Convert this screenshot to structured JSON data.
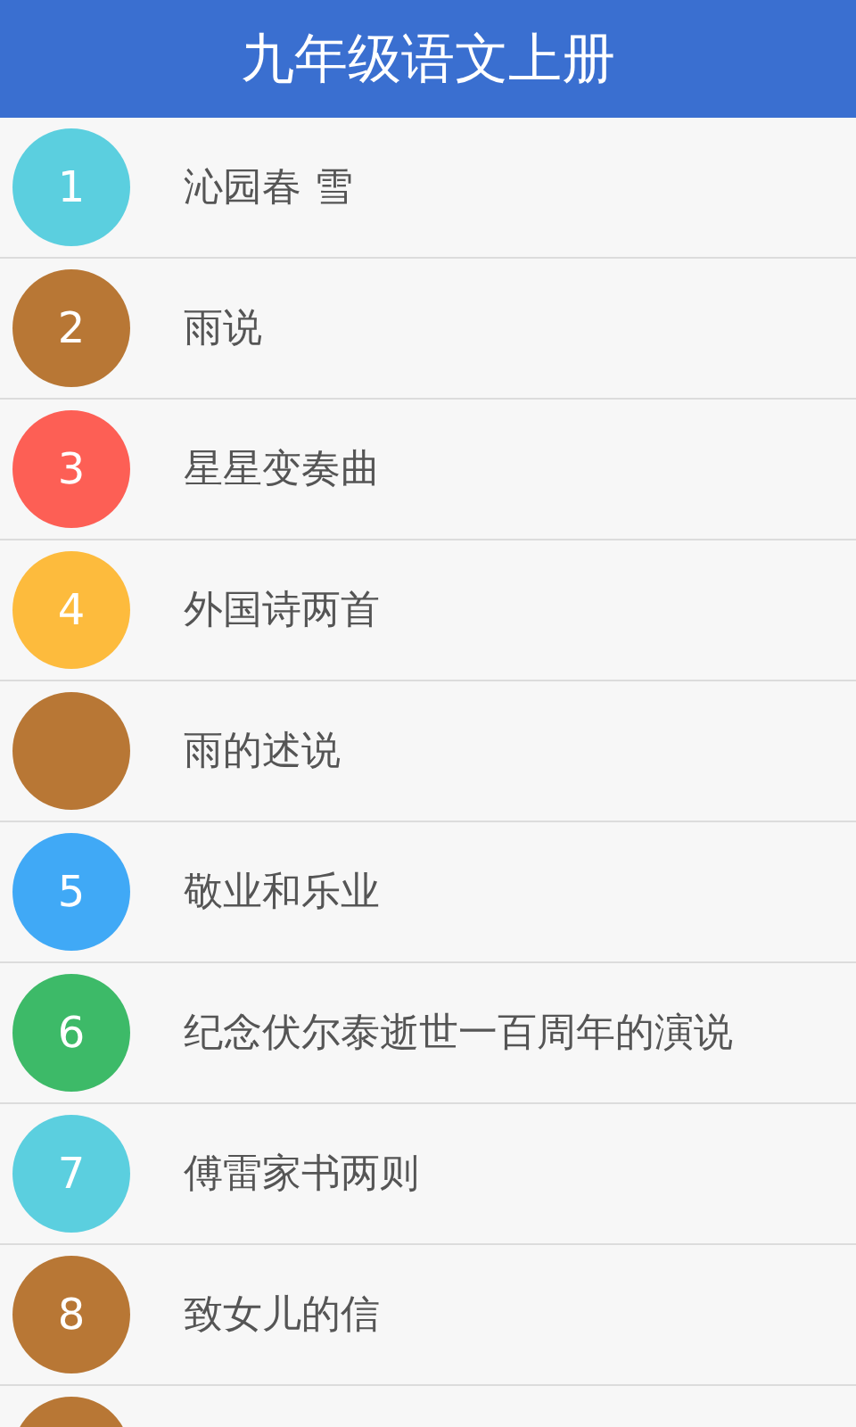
{
  "header": {
    "title": "九年级语文上册"
  },
  "lessons": [
    {
      "number": "1",
      "title": "沁园春 雪",
      "color": "#5bcfdf"
    },
    {
      "number": "2",
      "title": "雨说",
      "color": "#b87735"
    },
    {
      "number": "3",
      "title": "星星变奏曲",
      "color": "#fd5f55"
    },
    {
      "number": "4",
      "title": "外国诗两首",
      "color": "#fdbb3d"
    },
    {
      "title": "雨的述说",
      "color": "#b87735"
    },
    {
      "number": "5",
      "title": "敬业和乐业",
      "color": "#40a9f6"
    },
    {
      "number": "6",
      "title": "纪念伏尔泰逝世一百周年的演说",
      "color": "#3dba68"
    },
    {
      "number": "7",
      "title": "傅雷家书两则",
      "color": "#5bcfdf"
    },
    {
      "number": "8",
      "title": "致女儿的信",
      "color": "#b87735"
    },
    {
      "color": "#b87735"
    }
  ]
}
